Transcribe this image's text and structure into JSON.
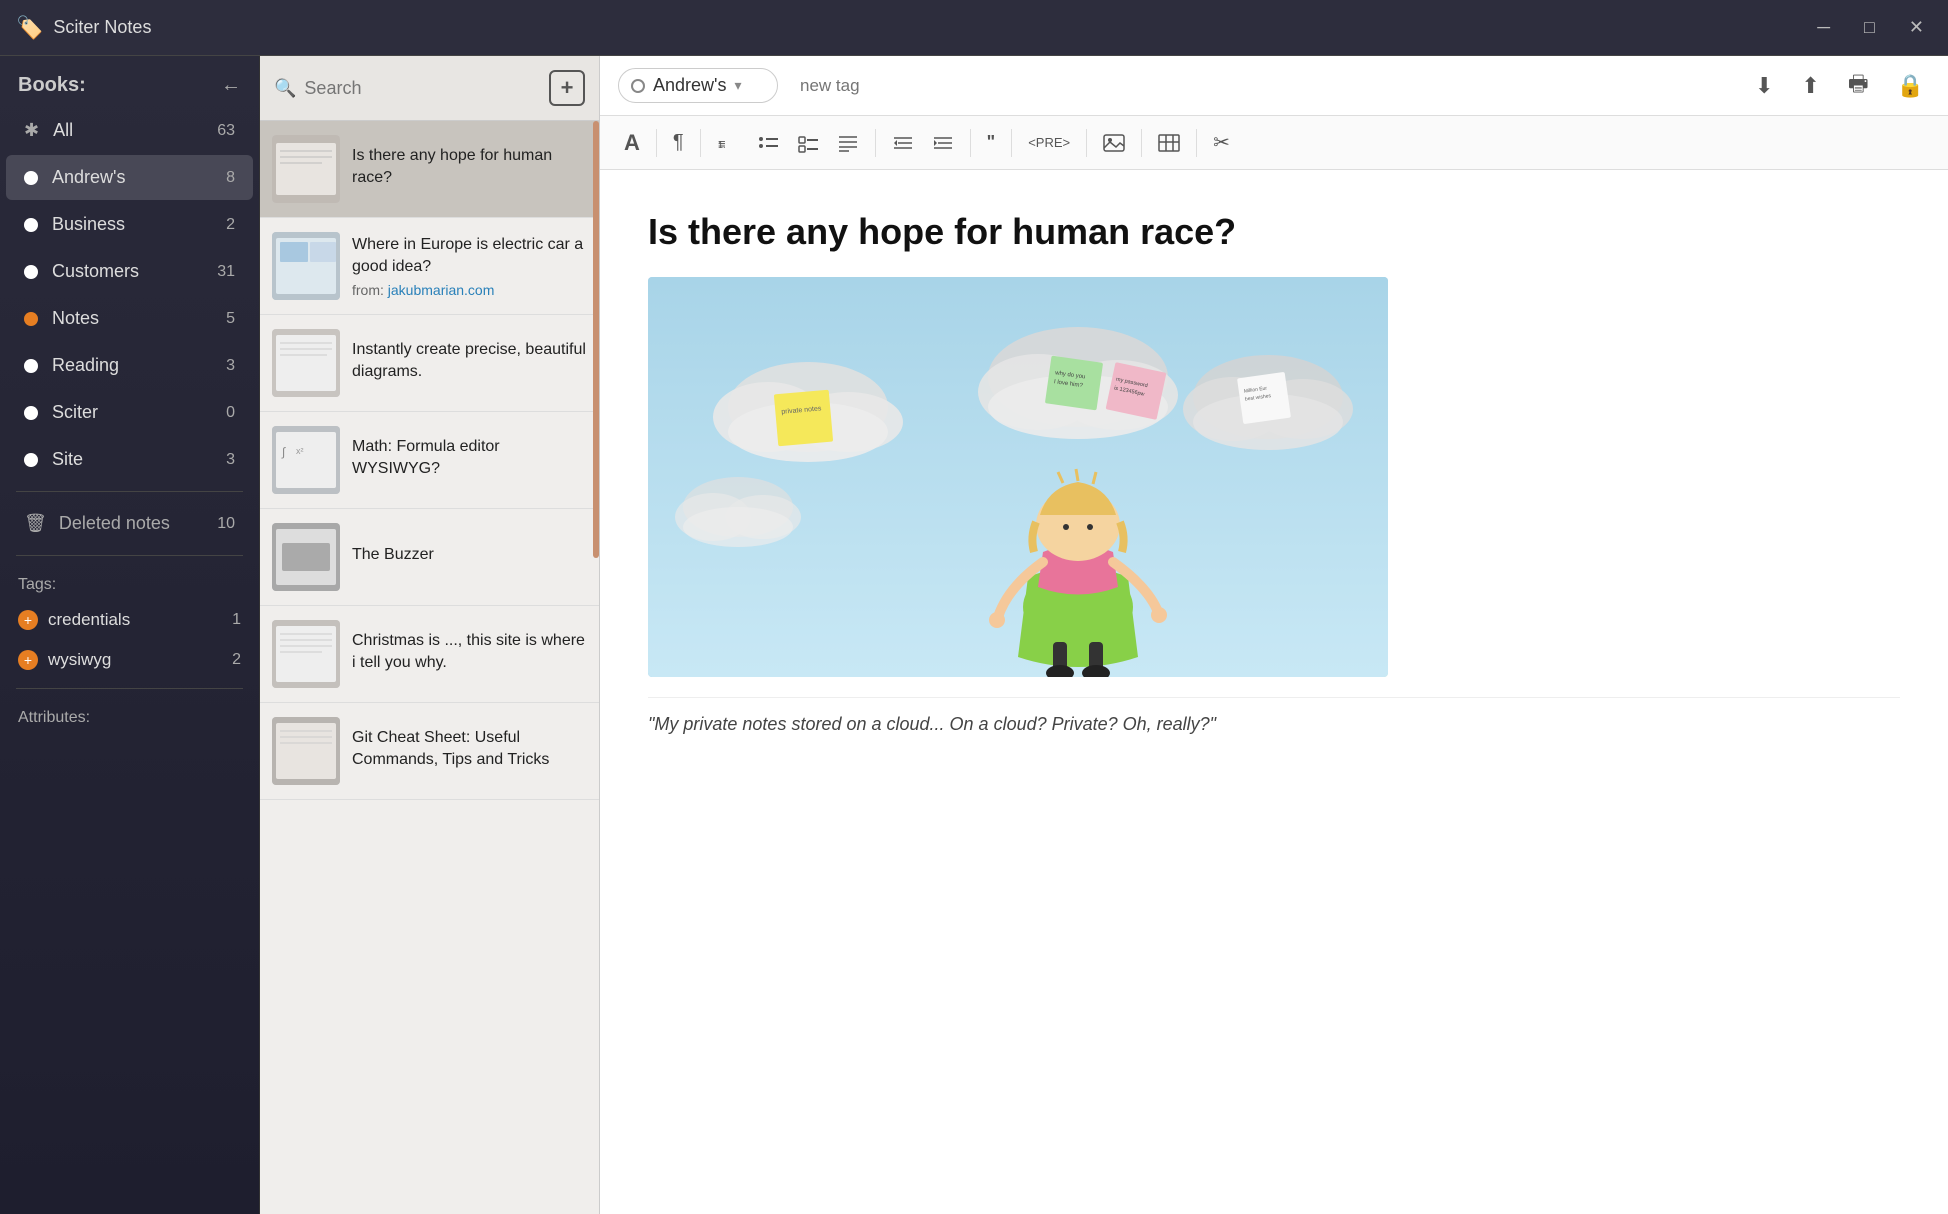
{
  "app": {
    "title": "Sciter Notes",
    "icon": "🏷️"
  },
  "titlebar": {
    "minimize_label": "─",
    "maximize_label": "□",
    "close_label": "✕"
  },
  "sidebar": {
    "header_label": "Books:",
    "back_arrow": "←",
    "items": [
      {
        "id": "all",
        "label": "All",
        "count": "63",
        "dot_color": null,
        "is_star": true
      },
      {
        "id": "andrews",
        "label": "Andrew's",
        "count": "8",
        "dot_color": "#ffffff",
        "active": true
      },
      {
        "id": "business",
        "label": "Business",
        "count": "2",
        "dot_color": "#ffffff"
      },
      {
        "id": "customers",
        "label": "Customers",
        "count": "31",
        "dot_color": "#ffffff"
      },
      {
        "id": "notes",
        "label": "Notes",
        "count": "5",
        "dot_color": "#e67e22"
      },
      {
        "id": "reading",
        "label": "Reading",
        "count": "3",
        "dot_color": "#ffffff"
      },
      {
        "id": "sciter",
        "label": "Sciter",
        "count": "0",
        "dot_color": "#ffffff"
      },
      {
        "id": "site",
        "label": "Site",
        "count": "3",
        "dot_color": "#ffffff"
      }
    ],
    "deleted_label": "Deleted notes",
    "deleted_count": "10",
    "tags_header": "Tags:",
    "tags": [
      {
        "label": "credentials",
        "count": "1"
      },
      {
        "label": "wysiwyg",
        "count": "2"
      }
    ],
    "attributes_header": "Attributes:"
  },
  "notes_list": {
    "search_placeholder": "Search",
    "add_button_label": "+",
    "notes": [
      {
        "id": 1,
        "title": "Is there any hope for human race?",
        "subtitle": "",
        "active": true
      },
      {
        "id": 2,
        "title": "Where in Europe is electric car a good idea?",
        "subtitle": "from: jakubmarian.com",
        "has_link": true
      },
      {
        "id": 3,
        "title": "Instantly create precise, beautiful diagrams.",
        "subtitle": ""
      },
      {
        "id": 4,
        "title": "Math: Formula editor WYSIWYG?",
        "subtitle": ""
      },
      {
        "id": 5,
        "title": "The Buzzer",
        "subtitle": ""
      },
      {
        "id": 6,
        "title": "Christmas is ..., this site is where i tell you why.",
        "subtitle": ""
      },
      {
        "id": 7,
        "title": "Git Cheat Sheet: Useful Commands, Tips and Tricks",
        "subtitle": ""
      }
    ]
  },
  "content": {
    "book_name": "Andrew's",
    "tag_placeholder": "new tag",
    "title": "Is there any hope for human race?",
    "quote": "\"My private notes stored on a cloud... On a cloud? Private? Oh, really?\"",
    "toolbar_buttons": [
      "A",
      "¶",
      "≡",
      "≡",
      "≡",
      "≡",
      "⇤",
      "⇥",
      "❝",
      "<PRE>",
      "🖼",
      "⊞",
      "✂"
    ],
    "action_buttons": [
      "⬇",
      "⬆",
      "🖶",
      "🔒"
    ]
  }
}
